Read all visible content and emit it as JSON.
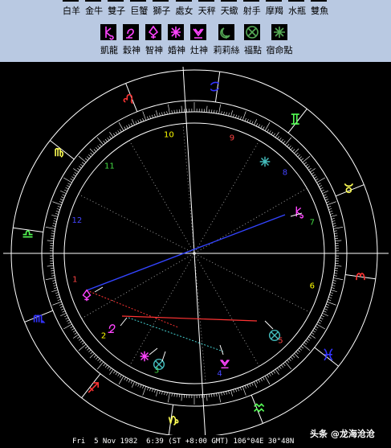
{
  "legend": {
    "signs": [
      {
        "label": "白羊",
        "icon": "aries-icon"
      },
      {
        "label": "金牛",
        "icon": "taurus-icon"
      },
      {
        "label": "雙子",
        "icon": "gemini-icon"
      },
      {
        "label": "巨蟹",
        "icon": "cancer-icon"
      },
      {
        "label": "獅子",
        "icon": "leo-icon"
      },
      {
        "label": "處女",
        "icon": "virgo-icon"
      },
      {
        "label": "天秤",
        "icon": "libra-icon"
      },
      {
        "label": "天蠍",
        "icon": "scorpio-icon"
      },
      {
        "label": "射手",
        "icon": "sagittarius-icon"
      },
      {
        "label": "摩羯",
        "icon": "capricorn-icon"
      },
      {
        "label": "水瓶",
        "icon": "aquarius-icon"
      },
      {
        "label": "雙魚",
        "icon": "pisces-icon"
      }
    ],
    "points": [
      {
        "label": "凱龍",
        "icon": "chiron-icon",
        "color": "#ff44ff"
      },
      {
        "label": "穀神",
        "icon": "ceres-icon",
        "color": "#ff44ff"
      },
      {
        "label": "智神",
        "icon": "pallas-icon",
        "color": "#ff44ff"
      },
      {
        "label": "婚神",
        "icon": "juno-icon",
        "color": "#ff44ff"
      },
      {
        "label": "灶神",
        "icon": "vesta-icon",
        "color": "#ff44ff"
      },
      {
        "label": "莉莉絲",
        "icon": "lilith-icon",
        "color": "#55aa55"
      },
      {
        "label": "福點",
        "icon": "fortune-icon",
        "color": "#55aa55"
      },
      {
        "label": "宿命點",
        "icon": "vertex-icon",
        "color": "#55aa55"
      }
    ]
  },
  "chart": {
    "houses": [
      "1",
      "2",
      "3",
      "4",
      "5",
      "6",
      "7",
      "8",
      "9",
      "10",
      "11",
      "12"
    ],
    "colors": {
      "fire": "#ff3333",
      "earth": "#ffff55",
      "air": "#55ff55",
      "water": "#3333ff",
      "house_number": "#ffff00",
      "house_number_red": "#ff4444",
      "house_number_green": "#44dd44",
      "house_number_blue": "#4444ff"
    }
  },
  "footer": {
    "date_line": "Fri  5 Nov 1982  6:39 (ST +8:00 GMT) 106°04E 30°48N"
  },
  "watermark": {
    "text": "头条 @龙海沧沧"
  }
}
